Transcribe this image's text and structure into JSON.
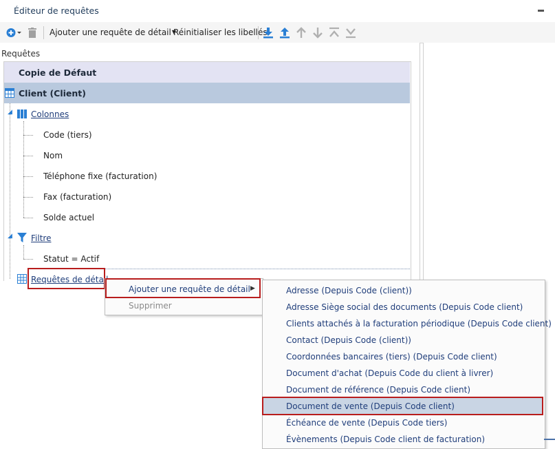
{
  "window": {
    "title": "Éditeur de requêtes"
  },
  "toolbar": {
    "add_icon": "plus-circle-dropdown",
    "delete_icon": "trash-can",
    "add_detail_label": "Ajouter une requête de détail",
    "reset_label": "Réinitialiser les libellés",
    "download_icon": "arrow-down-to-line",
    "upload_icon": "arrow-up-from-line",
    "up_icon": "arrow-up",
    "down_icon": "arrow-down",
    "top_icon": "move-to-top",
    "bottom_icon": "move-to-bottom"
  },
  "panel": {
    "label": "Requêtes"
  },
  "tree": {
    "root_label": "Copie de Défaut",
    "entity_label": "Client (Client)",
    "columns_label": "Colonnes",
    "columns": [
      "Code (tiers)",
      "Nom",
      "Téléphone fixe (facturation)",
      "Fax (facturation)",
      "Solde actuel"
    ],
    "filter_label": "Filtre",
    "filter_value": "Statut = Actif",
    "detail_label": "Requêtes de détail"
  },
  "context_menu": {
    "add_detail": "Ajouter une requête de détail",
    "delete": "Supprimer"
  },
  "submenu": {
    "items": [
      "Adresse (Depuis Code (client))",
      "Adresse Siège social des documents (Depuis Code client)",
      "Clients attachés à la facturation périodique (Depuis Code client)",
      "Contact (Depuis Code (client))",
      "Coordonnées bancaires (tiers) (Depuis Code client)",
      "Document d'achat (Depuis Code du client à livrer)",
      "Document de référence (Depuis Code client)",
      "Document de vente (Depuis Code client)",
      "Échéance de vente (Depuis Code tiers)",
      "Évènements (Depuis Code client de facturation)"
    ],
    "highlighted_index": 7
  },
  "colors": {
    "accent_blue": "#2a7fd4",
    "selection_row": "#b9c9de",
    "root_row": "#e3e3f3",
    "highlight_border": "#b81c1c"
  }
}
